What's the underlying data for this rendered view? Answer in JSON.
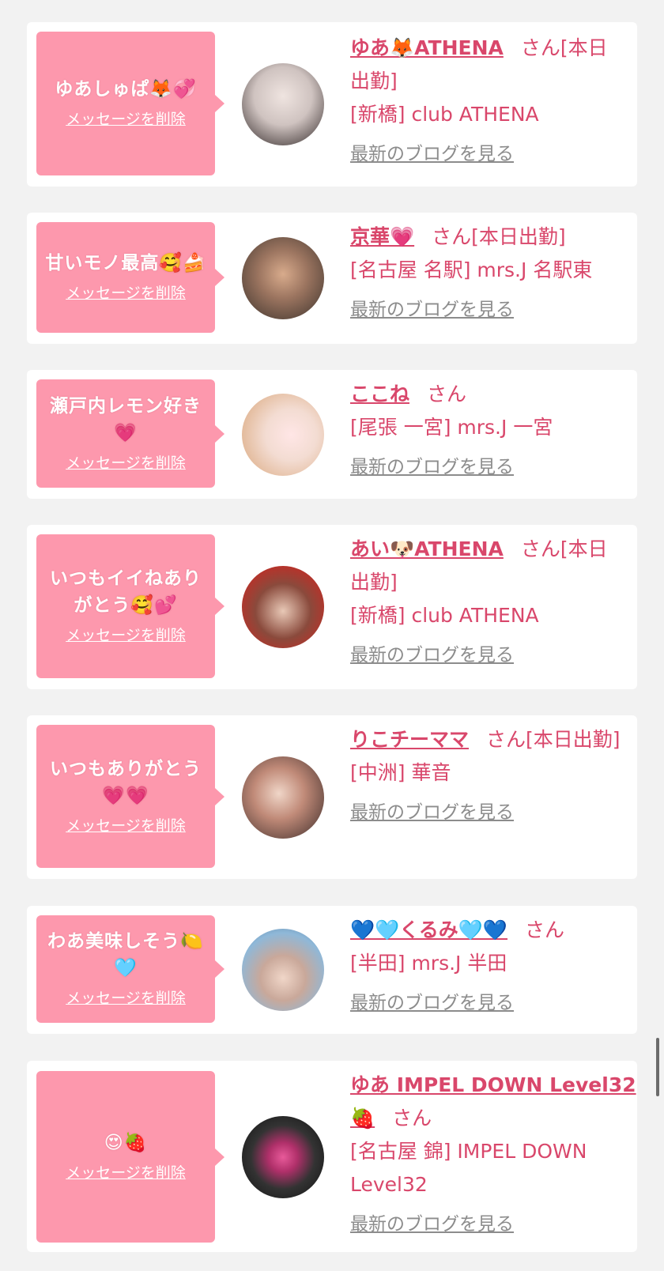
{
  "cards": [
    {
      "message": "ゆあしゅぱ🦊💞",
      "delete_label": "メッセージを削除",
      "name": "ゆあ🦊ATHENA",
      "honorific": "さん[本日出勤]",
      "shop": "[新橋] club ATHENA",
      "blog_label": "最新のブログを見る",
      "avatar_colors": [
        "#cfc3c0",
        "#2e2525"
      ]
    },
    {
      "message": "甘いモノ最高🥰🍰",
      "delete_label": "メッセージを削除",
      "name": "京華💗",
      "honorific": "さん[本日出勤]",
      "shop": "[名古屋 名駅] mrs.J 名駅東",
      "blog_label": "最新のブログを見る",
      "avatar_colors": [
        "#4b3f35",
        "#c99a7a"
      ]
    },
    {
      "message": "瀬戸内レモン好き💗",
      "delete_label": "メッセージを削除",
      "name": "ここね",
      "honorific": "さん",
      "shop": "[尾張 一宮] mrs.J 一宮",
      "blog_label": "最新のブログを見る",
      "avatar_colors": [
        "#f3dcd2",
        "#d9a67a"
      ]
    },
    {
      "message": "いつもイイねありがとう🥰💕",
      "delete_label": "メッセージを削除",
      "name": "あい🐶ATHENA",
      "honorific": "さん[本日出勤]",
      "shop": "[新橋] club ATHENA",
      "blog_label": "最新のブログを見る",
      "avatar_colors": [
        "#b8322a",
        "#3a2420"
      ]
    },
    {
      "message": "いつもありがとう💗💗",
      "delete_label": "メッセージを削除",
      "name": "りこチーママ",
      "honorific": "さん[本日出勤]",
      "shop": "[中洲] 華音",
      "blog_label": "最新のブログを見る",
      "avatar_colors": [
        "#e2c2b4",
        "#3a2a28"
      ]
    },
    {
      "message": "わあ美味しそう🍋🩵",
      "delete_label": "メッセージを削除",
      "name": "💙🩵くるみ🩵💙",
      "honorific": "さん",
      "shop": "[半田] mrs.J 半田",
      "blog_label": "最新のブログを見る",
      "avatar_colors": [
        "#8fb8d8",
        "#e8d2c8"
      ]
    },
    {
      "message": "😍🍓",
      "delete_label": "メッセージを削除",
      "name": "ゆあ IMPEL DOWN Level32🍓",
      "honorific": "さん",
      "shop": "[名古屋 錦] IMPEL DOWN Level32",
      "blog_label": "最新のブログを見る",
      "avatar_colors": [
        "#111111",
        "#e85a9a"
      ]
    }
  ]
}
